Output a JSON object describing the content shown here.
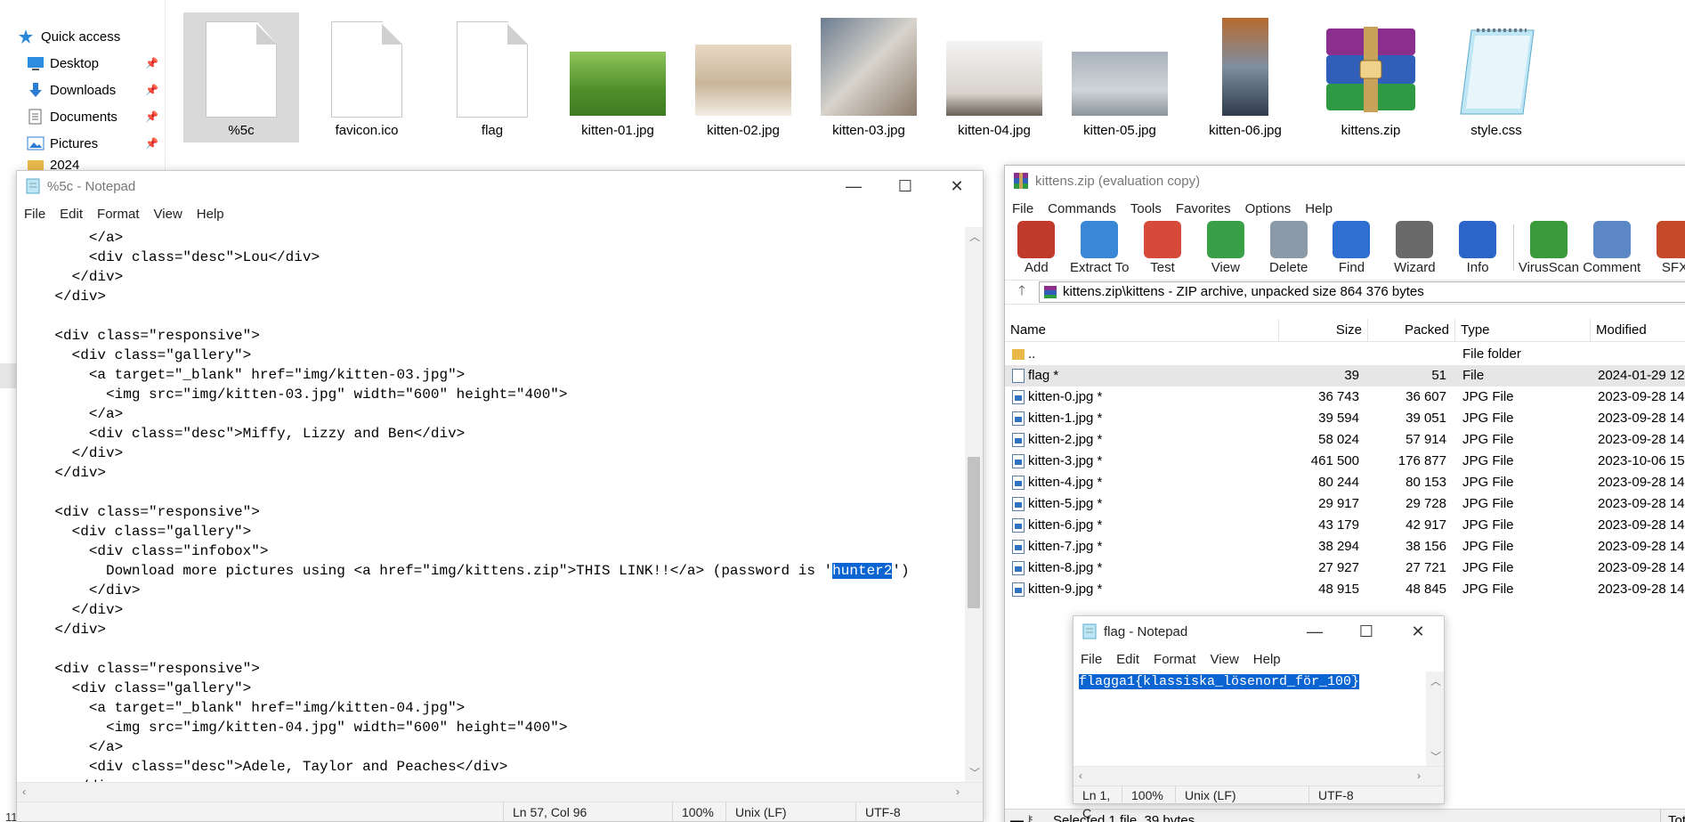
{
  "explorer": {
    "nav_items": [
      {
        "label": "Quick access",
        "icon": "star-icon"
      },
      {
        "label": "Desktop",
        "icon": "desktop-icon"
      },
      {
        "label": "Downloads",
        "icon": "download-icon"
      },
      {
        "label": "Documents",
        "icon": "documents-icon"
      },
      {
        "label": "Pictures",
        "icon": "pictures-icon"
      },
      {
        "label": "2024",
        "icon": "folder-icon"
      }
    ],
    "files": [
      {
        "name": "%5c",
        "kind": "doc",
        "selected": true
      },
      {
        "name": "favicon.ico",
        "kind": "doc"
      },
      {
        "name": "flag",
        "kind": "doc"
      },
      {
        "name": "kitten-01.jpg",
        "kind": "image"
      },
      {
        "name": "kitten-02.jpg",
        "kind": "image"
      },
      {
        "name": "kitten-03.jpg",
        "kind": "image"
      },
      {
        "name": "kitten-04.jpg",
        "kind": "image"
      },
      {
        "name": "kitten-05.jpg",
        "kind": "image"
      },
      {
        "name": "kitten-06.jpg",
        "kind": "image"
      },
      {
        "name": "kittens.zip",
        "kind": "archive"
      },
      {
        "name": "style.css",
        "kind": "notepad"
      }
    ],
    "side_number": "11"
  },
  "notepad_main": {
    "title": "%5c - Notepad",
    "menu": [
      "File",
      "Edit",
      "Format",
      "View",
      "Help"
    ],
    "lines": [
      "        </a>",
      "        <div class=\"desc\">Lou</div>",
      "      </div>",
      "    </div>",
      "",
      "    <div class=\"responsive\">",
      "      <div class=\"gallery\">",
      "        <a target=\"_blank\" href=\"img/kitten-03.jpg\">",
      "          <img src=\"img/kitten-03.jpg\" width=\"600\" height=\"400\">",
      "        </a>",
      "        <div class=\"desc\">Miffy, Lizzy and Ben</div>",
      "      </div>",
      "    </div>",
      "",
      "    <div class=\"responsive\">",
      "      <div class=\"gallery\">",
      "        <div class=\"infobox\">",
      "          Download more pictures using <a href=\"img/kittens.zip\">THIS LINK!!</a> (password is 'hunter2')",
      "        </div>",
      "      </div>",
      "    </div>",
      "",
      "    <div class=\"responsive\">",
      "      <div class=\"gallery\">",
      "        <a target=\"_blank\" href=\"img/kitten-04.jpg\">",
      "          <img src=\"img/kitten-04.jpg\" width=\"600\" height=\"400\">",
      "        </a>",
      "        <div class=\"desc\">Adele, Taylor and Peaches</div>",
      "      </div>"
    ],
    "selected_text": "hunter2",
    "status": {
      "position": "Ln 57, Col 96",
      "zoom": "100%",
      "eol": "Unix (LF)",
      "encoding": "UTF-8"
    }
  },
  "winrar": {
    "title": "kittens.zip (evaluation copy)",
    "menu": [
      "File",
      "Commands",
      "Tools",
      "Favorites",
      "Options",
      "Help"
    ],
    "toolbar": [
      {
        "label": "Add",
        "icon": "add-archive-icon",
        "color": "#c0392b"
      },
      {
        "label": "Extract To",
        "icon": "extract-folder-icon",
        "color": "#3a87d6"
      },
      {
        "label": "Test",
        "icon": "test-checklist-icon",
        "color": "#d64a3a"
      },
      {
        "label": "View",
        "icon": "view-book-icon",
        "color": "#3aa048"
      },
      {
        "label": "Delete",
        "icon": "delete-trash-icon",
        "color": "#8a9aa8"
      },
      {
        "label": "Find",
        "icon": "find-magnifier-icon",
        "color": "#2f6fd1"
      },
      {
        "label": "Wizard",
        "icon": "wizard-wand-icon",
        "color": "#6a6a6a"
      },
      {
        "label": "Info",
        "icon": "info-icon",
        "color": "#2c64c8"
      },
      {
        "label": "VirusScan",
        "icon": "virus-scan-icon",
        "color": "#3a9b3a"
      },
      {
        "label": "Comment",
        "icon": "comment-icon",
        "color": "#5b87c5"
      },
      {
        "label": "SFX",
        "icon": "sfx-icon",
        "color": "#c44a2a"
      }
    ],
    "address": "kittens.zip\\kittens - ZIP archive, unpacked size 864 376 bytes",
    "columns": [
      "Name",
      "Size",
      "Packed",
      "Type",
      "Modified"
    ],
    "rows": [
      {
        "name": "..",
        "size": "",
        "packed": "",
        "type": "File folder",
        "modified": "",
        "kind": "folder"
      },
      {
        "name": "flag *",
        "size": "39",
        "packed": "51",
        "type": "File",
        "modified": "2024-01-29 12:",
        "kind": "file",
        "selected": true
      },
      {
        "name": "kitten-0.jpg *",
        "size": "36 743",
        "packed": "36 607",
        "type": "JPG File",
        "modified": "2023-09-28 14:",
        "kind": "jpg"
      },
      {
        "name": "kitten-1.jpg *",
        "size": "39 594",
        "packed": "39 051",
        "type": "JPG File",
        "modified": "2023-09-28 14:",
        "kind": "jpg"
      },
      {
        "name": "kitten-2.jpg *",
        "size": "58 024",
        "packed": "57 914",
        "type": "JPG File",
        "modified": "2023-09-28 14:",
        "kind": "jpg"
      },
      {
        "name": "kitten-3.jpg *",
        "size": "461 500",
        "packed": "176 877",
        "type": "JPG File",
        "modified": "2023-10-06 15:",
        "kind": "jpg"
      },
      {
        "name": "kitten-4.jpg *",
        "size": "80 244",
        "packed": "80 153",
        "type": "JPG File",
        "modified": "2023-09-28 14:",
        "kind": "jpg"
      },
      {
        "name": "kitten-5.jpg *",
        "size": "29 917",
        "packed": "29 728",
        "type": "JPG File",
        "modified": "2023-09-28 14:",
        "kind": "jpg"
      },
      {
        "name": "kitten-6.jpg *",
        "size": "43 179",
        "packed": "42 917",
        "type": "JPG File",
        "modified": "2023-09-28 14:",
        "kind": "jpg"
      },
      {
        "name": "kitten-7.jpg *",
        "size": "38 294",
        "packed": "38 156",
        "type": "JPG File",
        "modified": "2023-09-28 14:",
        "kind": "jpg"
      },
      {
        "name": "kitten-8.jpg *",
        "size": "27 927",
        "packed": "27 721",
        "type": "JPG File",
        "modified": "2023-09-28 14:",
        "kind": "jpg"
      },
      {
        "name": "kitten-9.jpg *",
        "size": "48 915",
        "packed": "48 845",
        "type": "JPG File",
        "modified": "2023-09-28 14:",
        "kind": "jpg"
      }
    ],
    "status": "Selected 1 file, 39 bytes",
    "status_right": "Tota"
  },
  "notepad_flag": {
    "title": "flag - Notepad",
    "menu": [
      "File",
      "Edit",
      "Format",
      "View",
      "Help"
    ],
    "content": "flagga1{klassiska_lösenord_för_100}",
    "status": {
      "position": "Ln 1, C",
      "zoom": "100%",
      "eol": "Unix (LF)",
      "encoding": "UTF-8"
    }
  },
  "colors": {
    "selection": "#0a64d2",
    "tile_selected": "#d9d9d9"
  }
}
